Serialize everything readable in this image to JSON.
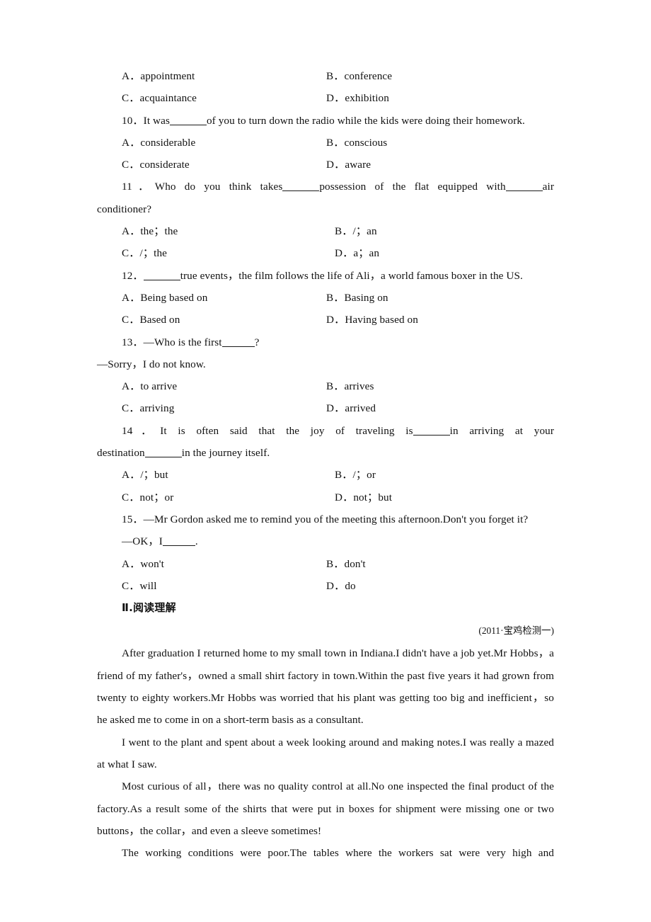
{
  "document": {
    "language": "en-zh",
    "text_color": "#111111",
    "background": "#ffffff"
  },
  "q9_options": {
    "a": "A．appointment",
    "b": "B．conference",
    "c": "C．acquaintance",
    "d": "D．exhibition"
  },
  "q10": {
    "stem_before": "10．It was",
    "stem_after": "of you to turn down the radio while the kids were doing their homework.",
    "options": {
      "a": "A．considerable",
      "b": "B．conscious",
      "c": "C．considerate",
      "d": "D．aware"
    }
  },
  "q11": {
    "line1_before": "11．Who do you think takes",
    "line1_mid": "possession of the flat equipped with",
    "line1_after": "air",
    "line2": "conditioner?",
    "options": {
      "a": "A．the；the",
      "b": "B．/；an",
      "c": "C．/；the",
      "d": "D．a；an"
    }
  },
  "q12": {
    "stem_before": "12．",
    "stem_after": "true events，the film follows the life of Ali，a world famous boxer in the US.",
    "options": {
      "a": "A．Being based on",
      "b": "B．Basing on",
      "c": "C．Based on",
      "d": "D．Having based on"
    }
  },
  "q13": {
    "stem_before": "13．—Who is the first",
    "stem_after": "?",
    "reply": "—Sorry，I do not know.",
    "options": {
      "a": "A．to arrive",
      "b": "B．arrives",
      "c": "C．arriving",
      "d": "D．arrived"
    }
  },
  "q14": {
    "line1_before": "14．It is often said that the joy of traveling is",
    "line1_after": "in arriving at your",
    "line2_before": "destination",
    "line2_after": "in the journey itself.",
    "options": {
      "a": "A．/；but",
      "b": "B．/；or",
      "c": "C．not；or",
      "d": "D．not；but"
    }
  },
  "q15": {
    "stem": "15．—Mr Gordon asked me to remind you of the meeting this afternoon.Don't you forget it?",
    "reply_before": "—OK，I",
    "reply_after": ".",
    "options": {
      "a": "A．won't",
      "b": "B．don't",
      "c": "C．will",
      "d": "D．do"
    }
  },
  "section2": {
    "heading": "Ⅱ.阅读理解",
    "source": "(2011·宝鸡检测一)"
  },
  "passage": {
    "paragraphs": [
      "After graduation I returned home to my small town in Indiana.I didn't have a job yet.Mr Hobbs，a friend of my father's，owned a small shirt factory in town.Within the past five years it had grown from twenty to eighty workers.Mr Hobbs was worried that his plant was getting too big and inefficient，so he asked me to come in on a short-term basis as a consultant.",
      "I went to the plant and spent about a week looking around and making notes.I was really a mazed at what I saw.",
      "Most curious of all，there was no quality control at all.No one inspected the final product of the factory.As a result some of the shirts that were put in boxes for shipment were missing one or two buttons，the collar，and even a sleeve sometimes!",
      "The working conditions were poor.The tables where the workers sat were very high and"
    ]
  }
}
